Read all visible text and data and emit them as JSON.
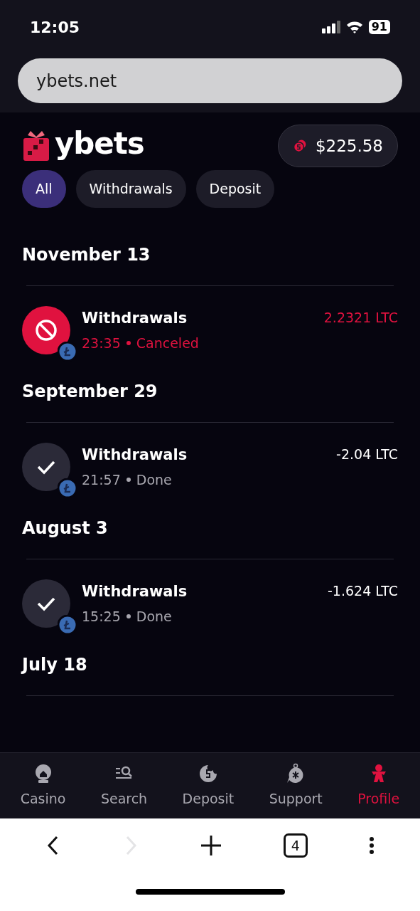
{
  "status_bar": {
    "time": "12:05",
    "battery": "91"
  },
  "address_bar": {
    "url": "ybets.net"
  },
  "header": {
    "logo": "ybets",
    "balance": "$225.58"
  },
  "filters": [
    {
      "label": "All",
      "selected": true
    },
    {
      "label": "Withdrawals",
      "selected": false
    },
    {
      "label": "Deposit",
      "selected": false
    }
  ],
  "groups": [
    {
      "date": "November 13",
      "transactions": [
        {
          "kind": "canceled",
          "title": "Withdrawals",
          "time": "23:35",
          "status": "Canceled",
          "amount": "2.2321 LTC"
        }
      ]
    },
    {
      "date": "September 29",
      "transactions": [
        {
          "kind": "done",
          "title": "Withdrawals",
          "time": "21:57",
          "status": "Done",
          "amount": "-2.04 LTC"
        }
      ]
    },
    {
      "date": "August 3",
      "transactions": [
        {
          "kind": "done",
          "title": "Withdrawals",
          "time": "15:25",
          "status": "Done",
          "amount": "-1.624 LTC"
        }
      ]
    },
    {
      "date": "July 18"
    }
  ],
  "bottom_nav": [
    {
      "label": "Casino",
      "selected": false
    },
    {
      "label": "Search",
      "selected": false
    },
    {
      "label": "Deposit",
      "selected": false
    },
    {
      "label": "Support",
      "selected": false
    },
    {
      "label": "Profile",
      "selected": true
    }
  ],
  "browser_toolbar": {
    "forward_disabled": true,
    "tab_count": "4"
  }
}
